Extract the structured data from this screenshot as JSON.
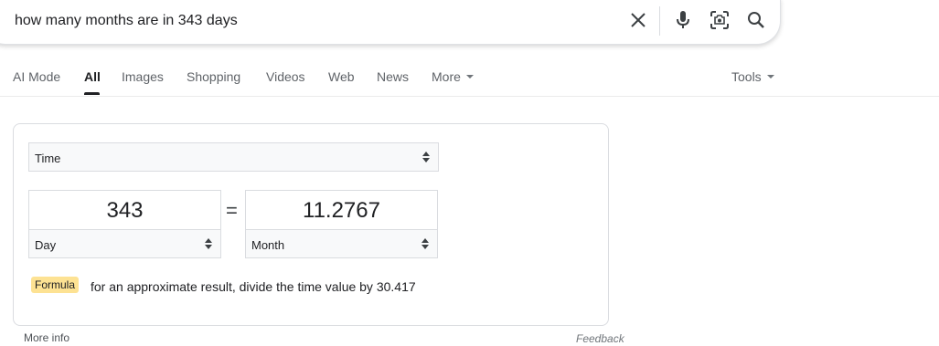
{
  "search": {
    "query": "how many months are in 343 days",
    "icons": {
      "clear": "close-icon",
      "voice": "microphone-icon",
      "lens": "camera-lens-icon",
      "search": "search-icon"
    }
  },
  "tabs": [
    {
      "label": "AI Mode",
      "active": false
    },
    {
      "label": "All",
      "active": true
    },
    {
      "label": "Images",
      "active": false
    },
    {
      "label": "Shopping",
      "active": false
    },
    {
      "label": "Videos",
      "active": false
    },
    {
      "label": "Web",
      "active": false
    },
    {
      "label": "News",
      "active": false
    },
    {
      "label": "More",
      "active": false
    }
  ],
  "tools_label": "Tools",
  "converter": {
    "category": "Time",
    "from": {
      "value": "343",
      "unit": "Day"
    },
    "equals": "=",
    "to": {
      "value": "11.2767",
      "unit": "Month"
    },
    "formula_label": "Formula",
    "formula_text": "for an approximate result, divide the time value by 30.417"
  },
  "footer": {
    "more_info": "More info",
    "feedback": "Feedback"
  },
  "colors": {
    "formula_badge": "#fde293",
    "border": "#dadce0",
    "select_bg": "#f8f9fa"
  }
}
